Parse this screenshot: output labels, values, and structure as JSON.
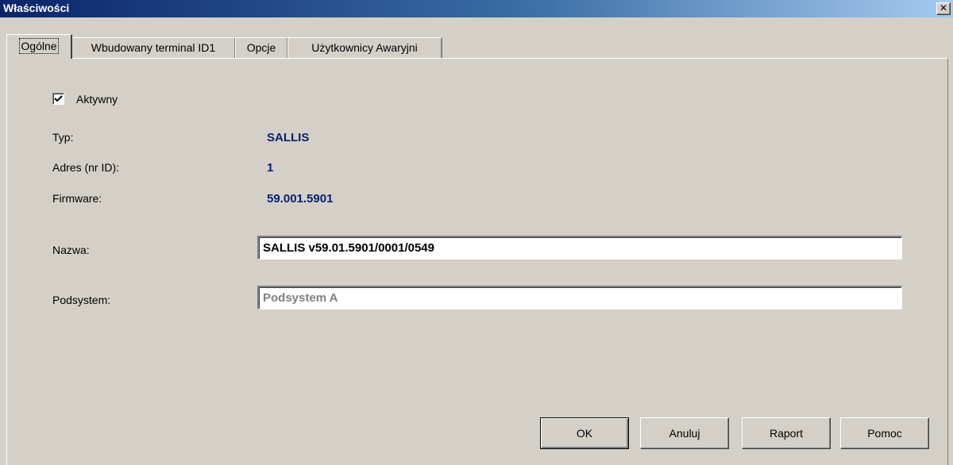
{
  "window": {
    "title": "Właściwości",
    "close_glyph": "✕"
  },
  "tabs": [
    {
      "label": "Ogólne",
      "active": true
    },
    {
      "label": "Wbudowany terminal ID1",
      "active": false
    },
    {
      "label": "Opcje",
      "active": false
    },
    {
      "label": "Użytkownicy Awaryjni",
      "active": false
    }
  ],
  "general": {
    "active_checkbox": {
      "label": "Aktywny",
      "checked": true
    },
    "type": {
      "label": "Typ:",
      "value": "SALLIS"
    },
    "address": {
      "label": "Adres (nr ID):",
      "value": "1"
    },
    "firmware": {
      "label": "Firmware:",
      "value": "59.001.5901"
    },
    "name": {
      "label": "Nazwa:",
      "value": "SALLIS v59.01.5901/0001/0549"
    },
    "subsystem": {
      "label": "Podsystem:",
      "value": "Podsystem A"
    }
  },
  "buttons": {
    "ok": "OK",
    "cancel": "Anuluj",
    "report": "Raport",
    "help": "Pomoc"
  },
  "colors": {
    "value_text": "#0a1e6e",
    "titlebar_start": "#0a246a",
    "titlebar_end": "#a6caf0"
  },
  "icons": {
    "close": "close-icon",
    "check": "checkmark-icon"
  }
}
